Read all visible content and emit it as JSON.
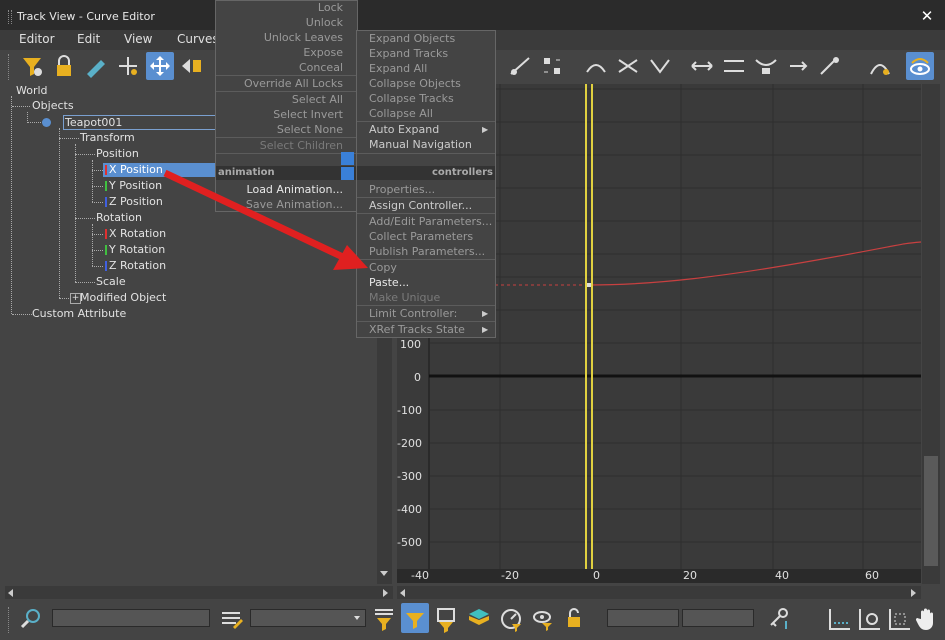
{
  "window": {
    "title": "Track View - Curve Editor",
    "close_glyph": "✕"
  },
  "menubar": {
    "items": [
      "Editor",
      "Edit",
      "View",
      "Curves"
    ]
  },
  "tree": {
    "world": "World",
    "objects": "Objects",
    "teapot": "Teapot001",
    "transform": "Transform",
    "position": "Position",
    "x_position": "X Position",
    "y_position": "Y Position",
    "z_position": "Z Position",
    "rotation": "Rotation",
    "x_rotation": "X Rotation",
    "y_rotation": "Y Rotation",
    "z_rotation": "Z Rotation",
    "scale": "Scale",
    "modified_object": "Modified Object",
    "custom_attribute": "Custom Attribute",
    "expand_glyph": "+"
  },
  "left_menu": {
    "items": [
      "Lock",
      "Unlock",
      "Unlock Leaves",
      "Expose",
      "Conceal",
      "Override All Locks",
      "Select All",
      "Select Invert",
      "Select None",
      "Select Children"
    ],
    "section_label": "animation",
    "load_animation": "Load Animation...",
    "save_animation": "Save Animation..."
  },
  "right_menu": {
    "items": [
      "Expand Objects",
      "Expand Tracks",
      "Expand All",
      "Collapse Objects",
      "Collapse Tracks",
      "Collapse All"
    ],
    "auto_expand": "Auto Expand",
    "manual_navigation": "Manual Navigation",
    "section_label": "controllers",
    "properties": "Properties...",
    "assign_controller": "Assign Controller...",
    "add_edit_parameters": "Add/Edit Parameters...",
    "collect_parameters": "Collect Parameters",
    "publish_parameters": "Publish Parameters...",
    "copy": "Copy",
    "paste": "Paste...",
    "make_unique": "Make Unique",
    "limit_controller": "Limit Controller:",
    "xref_tracks_state": "XRef Tracks State",
    "submenu_glyph": "▶"
  },
  "graph": {
    "y_ticks": [
      "100",
      "0",
      "-100",
      "-200",
      "-300",
      "-400",
      "-500"
    ],
    "x_ticks": [
      "-40",
      "-20",
      "0",
      "20",
      "40",
      "60"
    ],
    "curve_color": "#c84040",
    "time_slider_color": "#e0d040"
  },
  "colors": {
    "accent": "#5a8fd0",
    "arrow": "#e02020"
  }
}
